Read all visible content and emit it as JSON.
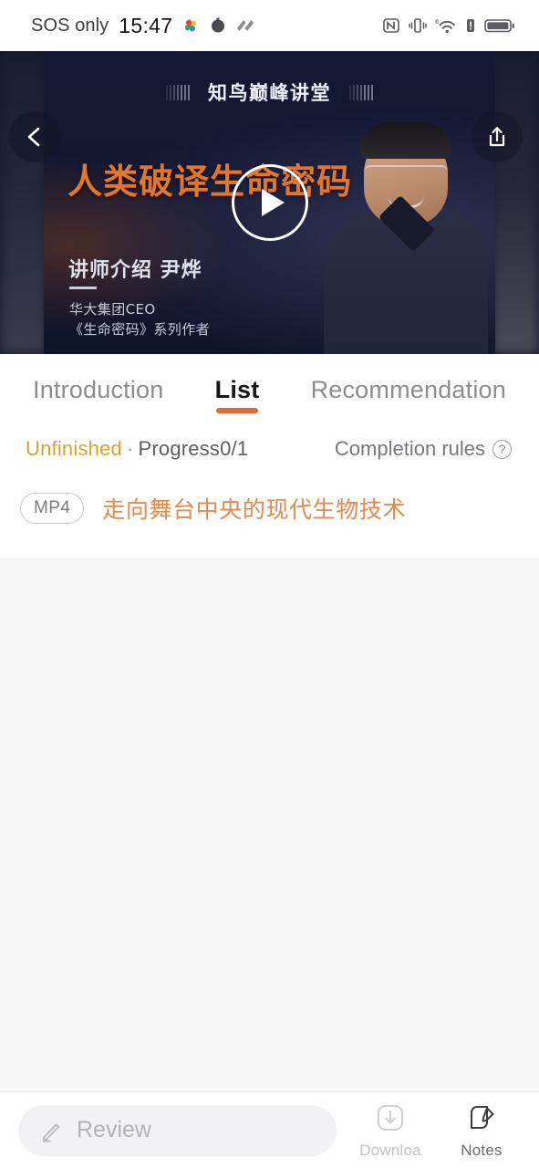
{
  "status_bar": {
    "carrier": "SOS only",
    "time": "15:47",
    "left_icons": [
      "pinwheel-icon",
      "app-icon",
      "waves-icon"
    ],
    "right_icons": [
      "nfc-icon",
      "vibrate-icon",
      "wifi6-icon",
      "signal-alert-icon",
      "battery-icon"
    ],
    "wifi_label": "6"
  },
  "banner": {
    "header_title": "知鸟巅峰讲堂",
    "kv_title": "人类破译生命密码",
    "speaker_line": "讲师介绍  尹烨",
    "speaker_role": "华大集团CEO",
    "speaker_books": "《生命密码》系列作者",
    "back_label": "Back",
    "share_label": "Share",
    "play_label": "Play"
  },
  "tabs": [
    {
      "label": "Introduction",
      "active": false
    },
    {
      "label": "List",
      "active": true
    },
    {
      "label": "Recommendation",
      "active": false
    }
  ],
  "progress": {
    "status": "Unfinished",
    "separator": "·",
    "progress_text": "Progress0/1",
    "completion_rules": "Completion rules",
    "help_glyph": "?"
  },
  "lessons": [
    {
      "format": "MP4",
      "title": "走向舞台中央的现代生物技术"
    }
  ],
  "bottom_bar": {
    "review_placeholder": "Review",
    "download_label": "Downloa",
    "notes_label": "Notes"
  },
  "colors": {
    "accent_orange": "#e0693c",
    "lesson_orange": "#e58a4d",
    "kv_orange": "#e2762c",
    "status_gold": "#d9a12f",
    "banner_dark": "#14172c"
  }
}
